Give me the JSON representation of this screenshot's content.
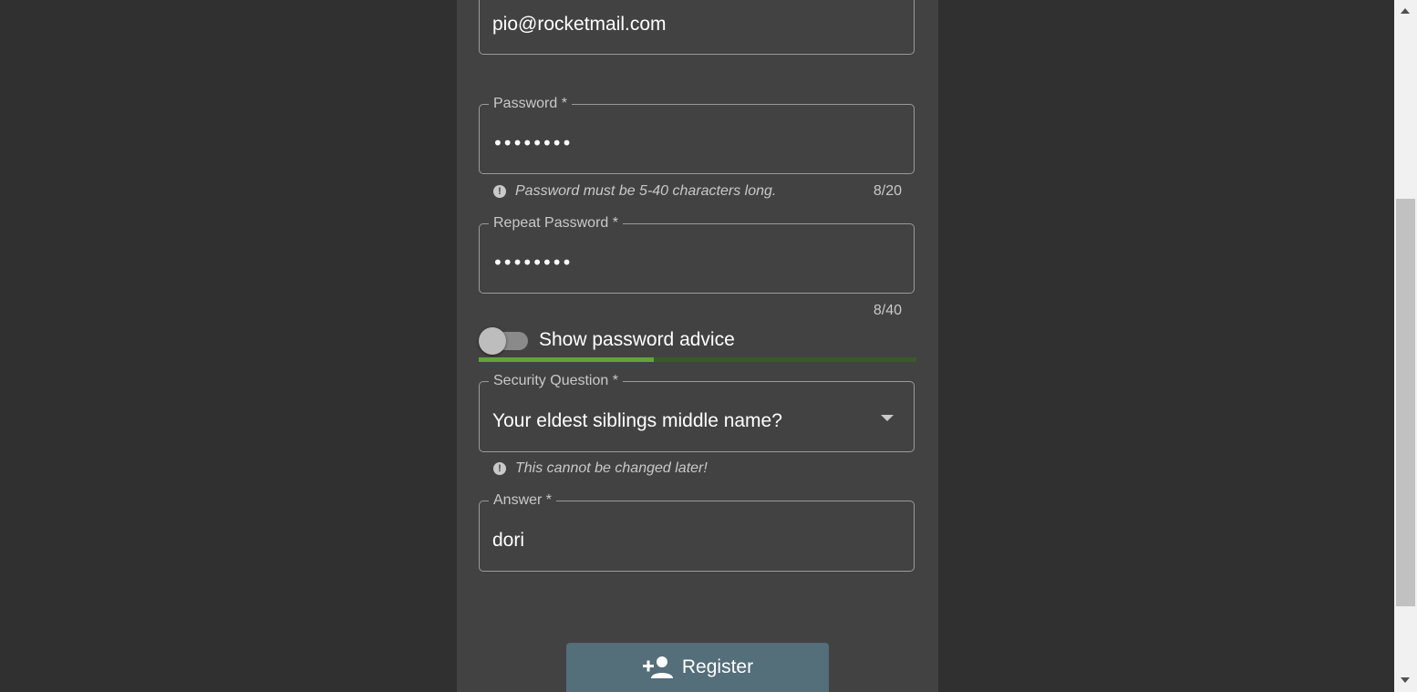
{
  "email": {
    "value": "pio@rocketmail.com"
  },
  "password": {
    "label": "Password *",
    "value": "••••••••",
    "hint": "Password must be 5-40 characters long.",
    "counter": "8/20"
  },
  "repeat_password": {
    "label": "Repeat Password *",
    "value": "••••••••",
    "counter": "8/40"
  },
  "password_advice": {
    "label": "Show password advice",
    "enabled": false,
    "strength_fraction": 0.4
  },
  "security_question": {
    "label": "Security Question *",
    "value": "Your eldest siblings middle name?",
    "hint": "This cannot be changed later!"
  },
  "answer": {
    "label": "Answer *",
    "value": "dori"
  },
  "register": {
    "label": "Register"
  },
  "colors": {
    "page_bg": "#303030",
    "card_bg": "#424242",
    "strength_fill": "#66a23a",
    "strength_track": "#3a5a2a",
    "register_button": "#546e7a"
  }
}
